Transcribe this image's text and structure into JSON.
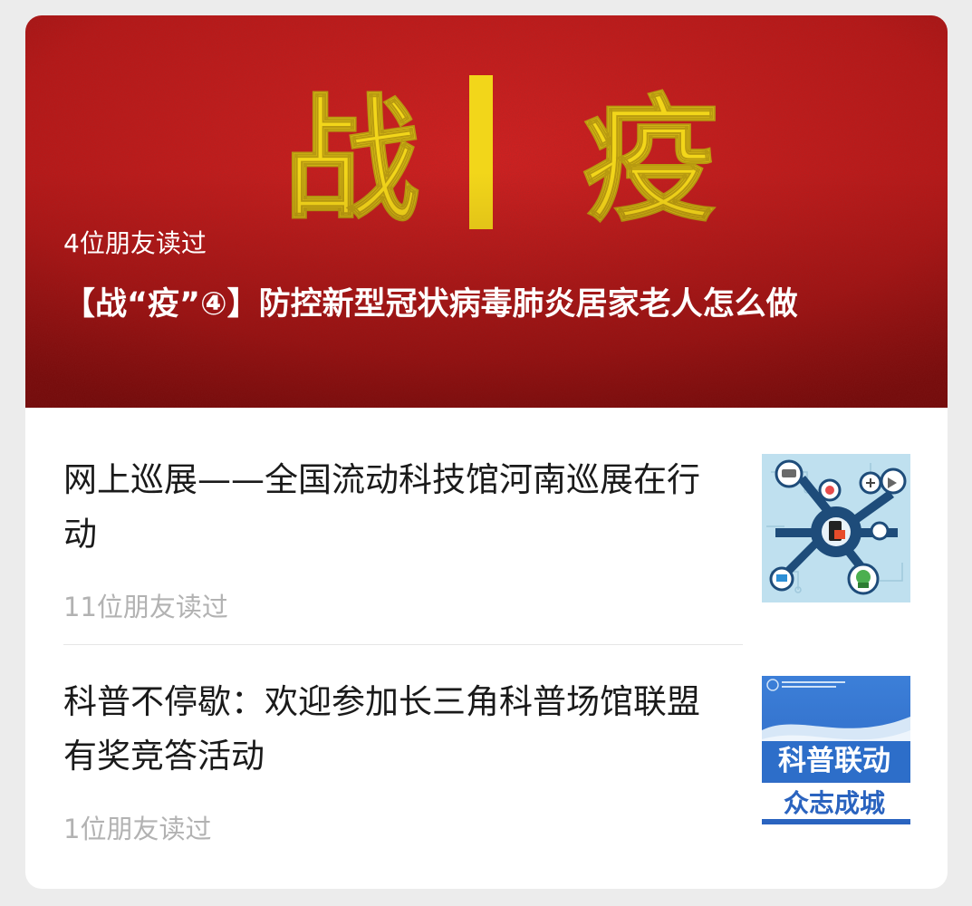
{
  "hero": {
    "banner_text_left": "战",
    "banner_text_right": "疫",
    "friends_read": "4位朋友读过",
    "title": "【战“疫”④】防控新型冠状病毒肺炎居家老人怎么做"
  },
  "articles": [
    {
      "title": "网上巡展——全国流动科技馆河南巡展在行动",
      "friends_read": "11位朋友读过",
      "thumbnail_icon": "science-network-icon"
    },
    {
      "title": "科普不停歇：欢迎参加长三角科普场馆联盟有奖竞答活动",
      "friends_read": "1位朋友读过",
      "thumbnail_icon": "science-linkage-banner",
      "thumbnail_text_top": "科普联动",
      "thumbnail_text_bottom": "众志成城"
    }
  ],
  "colors": {
    "hero_red": "#c41a1a",
    "banner_yellow": "#f2d61a",
    "muted_text": "#b2b2b2",
    "main_text": "#1a1a1a",
    "thumb_blue": "#2d6ec9"
  }
}
